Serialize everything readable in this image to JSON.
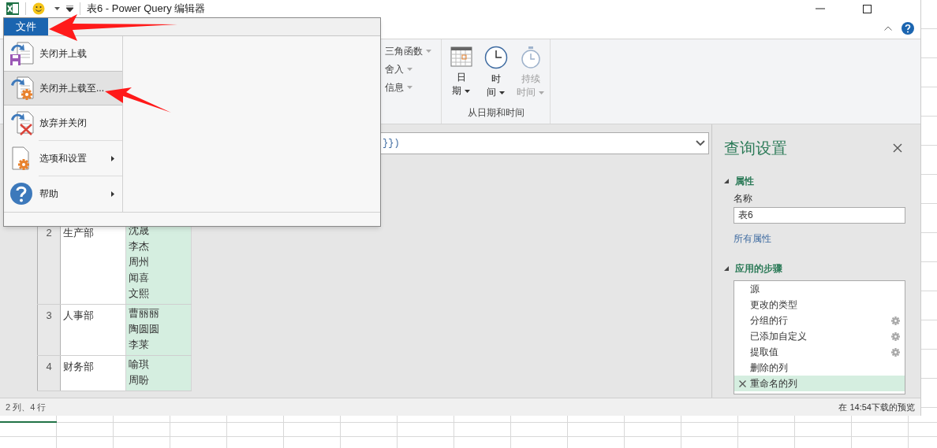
{
  "title_bar": {
    "title": "表6 - Power Query 编辑器"
  },
  "file_menu": {
    "tab": "文件",
    "items": [
      {
        "kind": "load",
        "label": "关闭并上载",
        "selected": false
      },
      {
        "kind": "load_to",
        "label": "关闭并上载至...",
        "selected": true
      },
      {
        "kind": "discard",
        "label": "放弃并关闭",
        "selected": false
      },
      {
        "kind": "options",
        "label": "选项和设置",
        "submenu": true,
        "selected": false
      },
      {
        "kind": "help",
        "label": "帮助",
        "submenu": true,
        "selected": false
      }
    ]
  },
  "ribbon": {
    "list_buttons": [
      {
        "label": "三角函数"
      },
      {
        "label": "舍入"
      },
      {
        "label": "信息"
      }
    ],
    "date_buttons": [
      {
        "kind": "calendar",
        "lines": [
          "日",
          "期"
        ],
        "disabled": false
      },
      {
        "kind": "clock",
        "lines": [
          "时",
          "间"
        ],
        "disabled": false
      },
      {
        "kind": "stopwatch",
        "lines": [
          "持续",
          "时间"
        ],
        "disabled": true
      }
    ],
    "group_label": "从日期和时间"
  },
  "formula_bar": {
    "value": "}})"
  },
  "table": {
    "rows": [
      {
        "row_number": "2",
        "column_1": "生产部",
        "column_2": [
          "沈晟",
          "李杰",
          "周州",
          "闻喜",
          "文熙"
        ]
      },
      {
        "row_number": "3",
        "column_1": "人事部",
        "column_2": [
          "曹丽丽",
          "陶圆圆",
          "李莱"
        ]
      },
      {
        "row_number": "4",
        "column_1": "财务部",
        "column_2": [
          "喻琪",
          "周盼"
        ]
      }
    ]
  },
  "query_settings": {
    "title": "查询设置",
    "properties_heading": "属性",
    "name_label": "名称",
    "name_value": "表6",
    "all_properties": "所有属性",
    "steps_heading": "应用的步骤",
    "steps": [
      {
        "label": "源",
        "has_settings": false,
        "selected": false
      },
      {
        "label": "更改的类型",
        "has_settings": false,
        "selected": false
      },
      {
        "label": "分组的行",
        "has_settings": true,
        "selected": false
      },
      {
        "label": "已添加自定义",
        "has_settings": true,
        "selected": false
      },
      {
        "label": "提取值",
        "has_settings": true,
        "selected": false
      },
      {
        "label": "删除的列",
        "has_settings": false,
        "selected": false
      },
      {
        "label": "重命名的列",
        "has_settings": false,
        "selected": true
      }
    ]
  },
  "status_bar": {
    "left": "2 列、4 行",
    "right": "在 14:54下载的预览"
  }
}
